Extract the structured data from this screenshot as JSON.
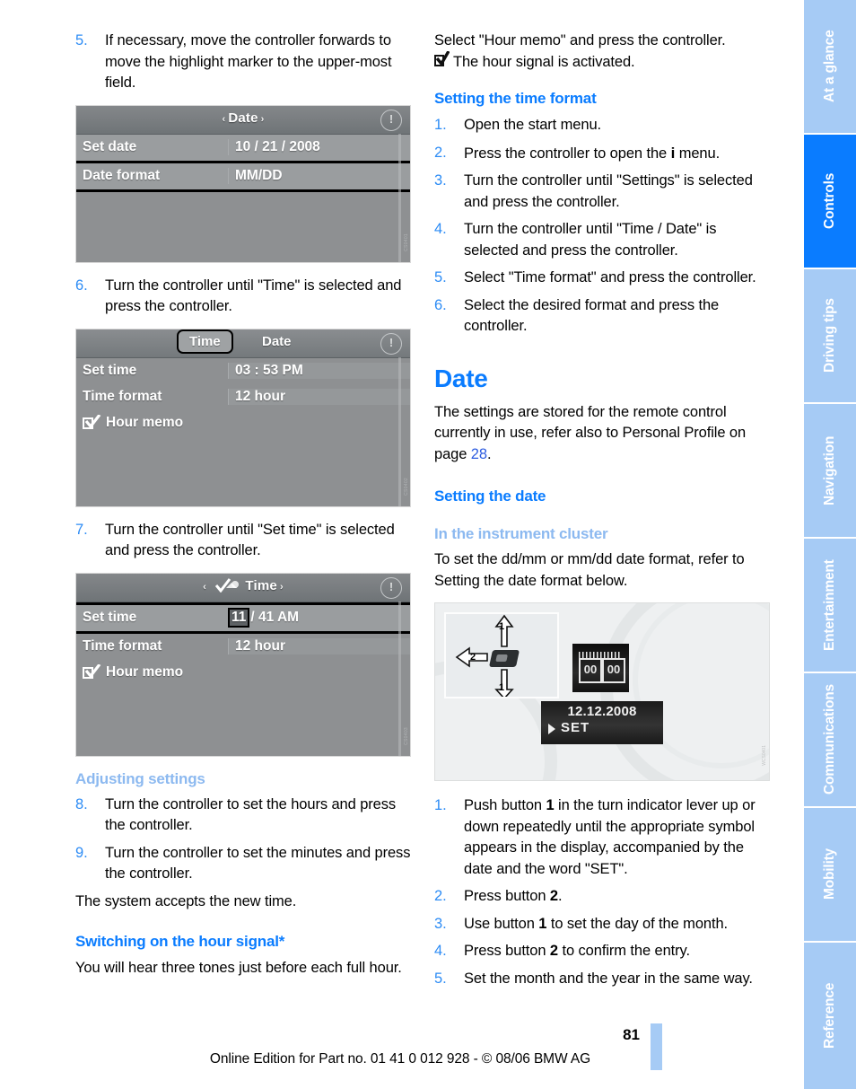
{
  "document": {
    "page_number": "81",
    "footer_note": "Online Edition for Part no. 01 41 0 012 928 - © 08/06 BMW AG"
  },
  "colors": {
    "accent_blue": "#0a7cff",
    "light_blue": "#a6cbf5",
    "sub_head_light": "#8cb9f0",
    "step_number": "#2d8cf5",
    "page_ref": "#2d5ce0"
  },
  "sidebar": {
    "tabs": [
      {
        "label": "At a glance",
        "active": false
      },
      {
        "label": "Controls",
        "active": true
      },
      {
        "label": "Driving tips",
        "active": false
      },
      {
        "label": "Navigation",
        "active": false
      },
      {
        "label": "Entertainment",
        "active": false
      },
      {
        "label": "Communications",
        "active": false
      },
      {
        "label": "Mobility",
        "active": false
      },
      {
        "label": "Reference",
        "active": false
      }
    ]
  },
  "left_column": {
    "step5": {
      "num": "5.",
      "text": "If necessary, move the controller forwards to move the highlight marker to the upper-most field."
    },
    "screen_date": {
      "title": "Date",
      "arrow_left": "‹",
      "arrow_right": "›",
      "clock_icon": "clock-icon",
      "rows": [
        {
          "label": "Set date",
          "value": "10 / 21 / 2008",
          "selected": false
        },
        {
          "label": "Date format",
          "value": "MM/DD",
          "selected": true
        }
      ],
      "watermark": "CS0401"
    },
    "step6": {
      "num": "6.",
      "text": "Turn the controller until \"Time\" is selected and press the controller."
    },
    "screen_time": {
      "tabs": [
        {
          "label": "Time",
          "selected": true
        },
        {
          "label": "Date",
          "selected": false
        }
      ],
      "clock_icon": "clock-icon",
      "rows": [
        {
          "label": "Set time",
          "value": "03 : 53 PM"
        },
        {
          "label": "Time format",
          "value": "12 hour"
        }
      ],
      "checkbox_row": {
        "label": "Hour memo",
        "checked": true
      },
      "watermark": "CS0402"
    },
    "step7": {
      "num": "7.",
      "text": "Turn the controller until \"Set time\" is selected and press the controller."
    },
    "screen_time_edit": {
      "title": "Time",
      "arrow_left": "‹",
      "arrow_right": "›",
      "clock_icon": "clock-icon",
      "check_icon": "check-icon",
      "rows": [
        {
          "label": "Set time",
          "value_highlight": "11",
          "value_rest": "/ 41 AM",
          "selected": true
        },
        {
          "label": "Time format",
          "value": "12 hour",
          "selected": false
        }
      ],
      "checkbox_row": {
        "label": "Hour memo",
        "checked": true
      },
      "watermark": "CS0403"
    },
    "adjusting_settings": {
      "heading": "Adjusting settings",
      "steps": [
        {
          "num": "8.",
          "text": "Turn the controller to set the hours and press the controller."
        },
        {
          "num": "9.",
          "text": "Turn the controller to set the minutes and press the controller."
        }
      ],
      "note": "The system accepts the new time."
    },
    "hour_signal": {
      "heading": "Switching on the hour signal*",
      "text": "You will hear three tones just before each full hour."
    }
  },
  "right_column": {
    "intro": {
      "line1": "Select \"Hour memo\" and press the controller.",
      "checkbox_icon": "checkbox-checked-icon",
      "line2": "The hour signal is activated."
    },
    "time_format": {
      "heading": "Setting the time format",
      "steps": [
        {
          "num": "1.",
          "text": "Open the start menu."
        },
        {
          "num": "2.",
          "text_before": "Press the controller to open the ",
          "icon": "info-i-icon",
          "text_after": " menu."
        },
        {
          "num": "3.",
          "text": "Turn the controller until \"Settings\" is selected and press the controller."
        },
        {
          "num": "4.",
          "text": "Turn the controller until \"Time / Date\" is selected and press the controller."
        },
        {
          "num": "5.",
          "text": "Select \"Time format\" and press the controller."
        },
        {
          "num": "6.",
          "text": "Select the desired format and press the controller."
        }
      ]
    },
    "date_section": {
      "title": "Date",
      "body_before": "The settings are stored for the remote control currently in use, refer also to Personal Profile on page ",
      "page_ref": "28",
      "body_after": ".",
      "setting_the_date": "Setting the date",
      "instrument_cluster_heading": "In the instrument cluster",
      "instrument_cluster_text": "To set the dd/mm or mm/dd date format, refer to Setting the date format below."
    },
    "cluster_photo": {
      "label_1_top": "1",
      "label_1_bottom": "1",
      "label_2": "2",
      "lcd_segment_left": "00",
      "lcd_segment_right": "00",
      "lcd_date": "12.12.2008",
      "lcd_set": "SET",
      "watermark": "WCS0401"
    },
    "cluster_steps": [
      {
        "num": "1.",
        "parts": [
          "Push button ",
          "1",
          " in the turn indicator lever up or down repeatedly until the appropriate symbol appears in the display, accompanied by the date and the word \"SET\"."
        ]
      },
      {
        "num": "2.",
        "parts": [
          "Press button ",
          "2",
          "."
        ]
      },
      {
        "num": "3.",
        "parts": [
          "Use button ",
          "1",
          " to set the day of the month."
        ]
      },
      {
        "num": "4.",
        "parts": [
          "Press button ",
          "2",
          " to confirm the entry."
        ]
      },
      {
        "num": "5.",
        "parts": [
          "Set the month and the year in the same way.",
          "",
          ""
        ]
      }
    ]
  }
}
